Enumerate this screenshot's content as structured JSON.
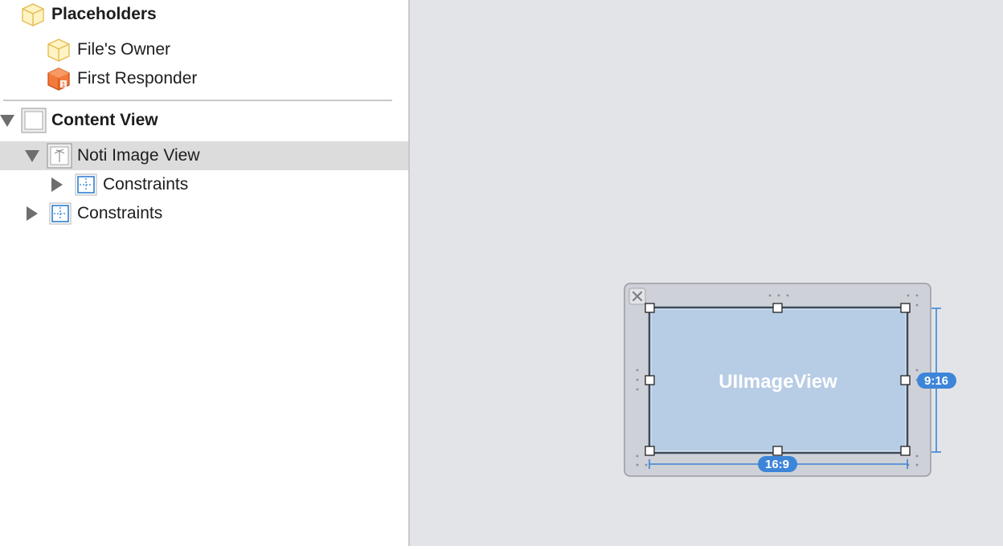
{
  "outline": {
    "items": [
      {
        "label": "Placeholders",
        "icon": "cube-placeholder-icon"
      },
      {
        "label": "File's Owner",
        "icon": "cube-placeholder-icon"
      },
      {
        "label": "First Responder",
        "icon": "first-responder-cube-icon"
      },
      {
        "label": "Content View",
        "icon": "view-icon"
      },
      {
        "label": "Noti Image View",
        "icon": "image-view-icon"
      },
      {
        "label": "Constraints",
        "icon": "constraints-icon"
      },
      {
        "label": "Constraints",
        "icon": "constraints-icon"
      }
    ],
    "selected_index": 4
  },
  "canvas": {
    "image_view_label": "UIImageView",
    "width_badge": "16:9",
    "height_badge": "9:16",
    "accent": "#3d85d8",
    "image_fill": "#b7cce5"
  }
}
